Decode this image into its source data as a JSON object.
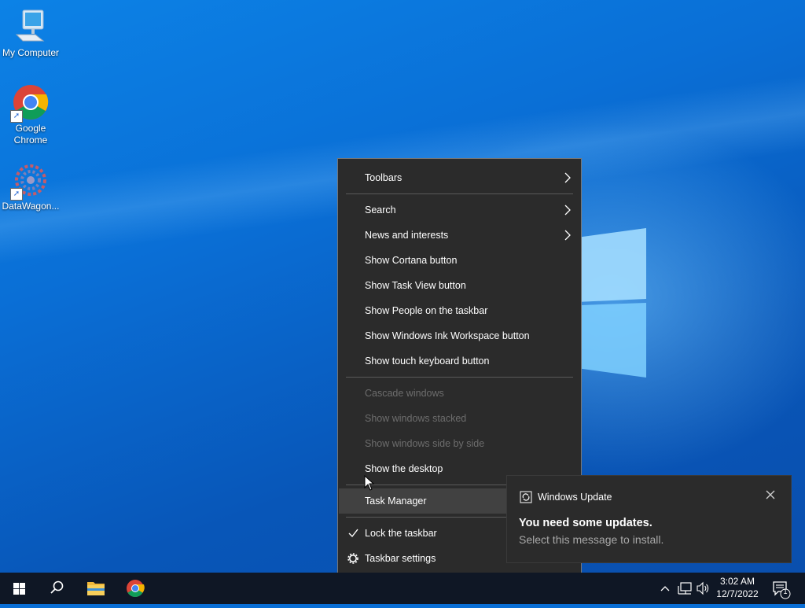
{
  "desktop": {
    "icons": [
      {
        "label": "My Computer",
        "icon": "computer-icon"
      },
      {
        "label": "Google Chrome",
        "icon": "chrome-icon"
      },
      {
        "label": "DataWagon...",
        "icon": "datawagon-icon"
      }
    ]
  },
  "context_menu": {
    "toolbars": "Toolbars",
    "search": "Search",
    "news": "News and interests",
    "cortana": "Show Cortana button",
    "task_view": "Show Task View button",
    "people": "Show People on the taskbar",
    "ink": "Show Windows Ink Workspace button",
    "touch_keyboard": "Show touch keyboard button",
    "cascade": "Cascade windows",
    "stacked": "Show windows stacked",
    "side_by_side": "Show windows side by side",
    "show_desktop": "Show the desktop",
    "task_manager": "Task Manager",
    "lock_taskbar": "Lock the taskbar",
    "taskbar_settings": "Taskbar settings"
  },
  "toast": {
    "app": "Windows Update",
    "title": "You need some updates.",
    "body": "Select this message to install."
  },
  "taskbar": {
    "time": "3:02 AM",
    "date": "12/7/2022",
    "notification_count": "1"
  },
  "colors": {
    "menu_bg": "#2b2b2b",
    "taskbar_bg": "#0f1725",
    "desktop_blue": "#0a6fd6"
  }
}
